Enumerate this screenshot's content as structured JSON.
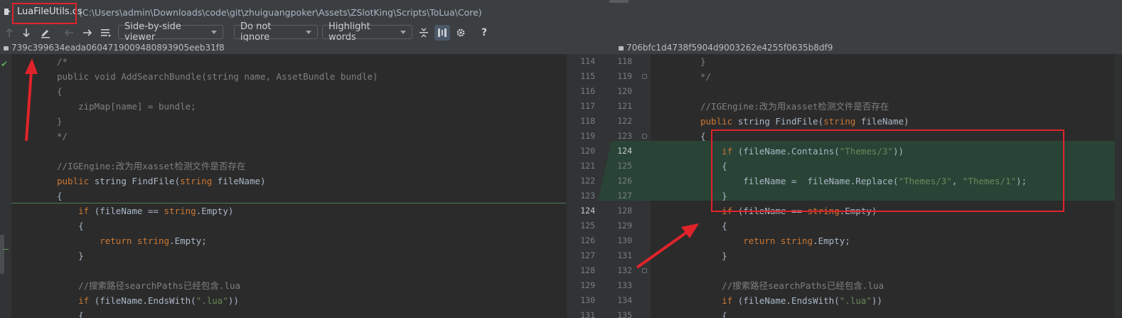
{
  "window": {
    "file_name": "LuaFileUtils.cs",
    "file_path": "(C:\\Users\\admin\\Downloads\\code\\git\\zhuiguangpoker\\Assets\\ZSlotKing\\Scripts\\ToLua\\Core)"
  },
  "toolbar": {
    "viewer_mode": "Side-by-side viewer",
    "ignore_mode": "Do not ignore",
    "highlight_mode": "Highlight words",
    "help_label": "?"
  },
  "revisions": {
    "left_hash": "739c399634eada0604719009480893905eeb31f8",
    "right_hash": "706bfc1d4738f5904d9003262e4255f0635b8df9"
  },
  "left_lines": [
    [
      {
        "t": "/*",
        "c": "cm"
      }
    ],
    [
      {
        "t": "public ",
        "c": "cm"
      },
      {
        "t": "void AddSearchBundle(string name, AssetBundle bundle)",
        "c": "cm"
      }
    ],
    [
      {
        "t": "{",
        "c": "cm"
      }
    ],
    [
      {
        "t": "    zipMap[name] = bundle;",
        "c": "cm"
      }
    ],
    [
      {
        "t": "}",
        "c": "cm"
      }
    ],
    [
      {
        "t": "*/",
        "c": "cm"
      }
    ],
    [
      {
        "t": "",
        "c": ""
      }
    ],
    [
      {
        "t": "//IGEngine:改为用xasset检测文件是否存在",
        "c": "cm"
      }
    ],
    [
      {
        "t": "public ",
        "c": "kw"
      },
      {
        "t": "string FindFile(",
        "c": ""
      },
      {
        "t": "string ",
        "c": "kw"
      },
      {
        "t": "fileName)",
        "c": ""
      }
    ],
    [
      {
        "t": "{",
        "c": ""
      }
    ],
    [
      {
        "t": "    ",
        "c": ""
      },
      {
        "t": "if ",
        "c": "kw"
      },
      {
        "t": "(fileName == ",
        "c": ""
      },
      {
        "t": "string",
        "c": "kw"
      },
      {
        "t": ".Empty)",
        "c": ""
      }
    ],
    [
      {
        "t": "    {",
        "c": ""
      }
    ],
    [
      {
        "t": "        ",
        "c": ""
      },
      {
        "t": "return ",
        "c": "kw"
      },
      {
        "t": "string",
        "c": "kw"
      },
      {
        "t": ".Empty;",
        "c": ""
      }
    ],
    [
      {
        "t": "    }",
        "c": ""
      }
    ],
    [
      {
        "t": "",
        "c": ""
      }
    ],
    [
      {
        "t": "    //搜索路径searchPaths已经包含.lua",
        "c": "cm"
      }
    ],
    [
      {
        "t": "    ",
        "c": ""
      },
      {
        "t": "if ",
        "c": "kw"
      },
      {
        "t": "(fileName.EndsWith(",
        "c": ""
      },
      {
        "t": "\".lua\"",
        "c": "str"
      },
      {
        "t": "))",
        "c": ""
      }
    ],
    [
      {
        "t": "    {",
        "c": ""
      }
    ]
  ],
  "right_lines": [
    [
      {
        "t": "}",
        "c": "cm"
      }
    ],
    [
      {
        "t": "*/",
        "c": "cm"
      }
    ],
    [
      {
        "t": "",
        "c": ""
      }
    ],
    [
      {
        "t": "//IGEngine:改为用xasset检测文件是否存在",
        "c": "cm"
      }
    ],
    [
      {
        "t": "public ",
        "c": "kw"
      },
      {
        "t": "string FindFile(",
        "c": ""
      },
      {
        "t": "string ",
        "c": "kw"
      },
      {
        "t": "fileName)",
        "c": ""
      }
    ],
    [
      {
        "t": "{",
        "c": ""
      }
    ],
    [
      {
        "t": "    ",
        "c": ""
      },
      {
        "t": "if ",
        "c": "kw"
      },
      {
        "t": "(fileName.Contains(",
        "c": ""
      },
      {
        "t": "\"Themes/3\"",
        "c": "str"
      },
      {
        "t": "))",
        "c": ""
      }
    ],
    [
      {
        "t": "    {",
        "c": ""
      }
    ],
    [
      {
        "t": "        fileName =  fileName.Replace(",
        "c": ""
      },
      {
        "t": "\"Themes/3\"",
        "c": "str"
      },
      {
        "t": ", ",
        "c": ""
      },
      {
        "t": "\"Themes/1\"",
        "c": "str"
      },
      {
        "t": ");",
        "c": ""
      }
    ],
    [
      {
        "t": "    }",
        "c": ""
      }
    ],
    [
      {
        "t": "    ",
        "c": ""
      },
      {
        "t": "if ",
        "c": "kw"
      },
      {
        "t": "(fileName == ",
        "c": ""
      },
      {
        "t": "string",
        "c": "kw"
      },
      {
        "t": ".Empty)",
        "c": ""
      }
    ],
    [
      {
        "t": "    {",
        "c": ""
      }
    ],
    [
      {
        "t": "        ",
        "c": ""
      },
      {
        "t": "return ",
        "c": "kw"
      },
      {
        "t": "string",
        "c": "kw"
      },
      {
        "t": ".Empty;",
        "c": ""
      }
    ],
    [
      {
        "t": "    }",
        "c": ""
      }
    ],
    [
      {
        "t": "",
        "c": ""
      }
    ],
    [
      {
        "t": "    //搜索路径searchPaths已经包含.lua",
        "c": "cm"
      }
    ],
    [
      {
        "t": "    ",
        "c": ""
      },
      {
        "t": "if ",
        "c": "kw"
      },
      {
        "t": "(fileName.EndsWith(",
        "c": ""
      },
      {
        "t": "\".lua\"",
        "c": "str"
      },
      {
        "t": "))",
        "c": ""
      }
    ],
    [
      {
        "t": "    {",
        "c": ""
      }
    ]
  ],
  "left_line_numbers": [
    "114",
    "115",
    "116",
    "117",
    "118",
    "119",
    "120",
    "121",
    "122",
    "123",
    "124",
    "125",
    "126",
    "127",
    "128",
    "129",
    "130",
    "131"
  ],
  "right_line_numbers": [
    "118",
    "119",
    "120",
    "121",
    "122",
    "123",
    "124",
    "125",
    "126",
    "127",
    "128",
    "129",
    "130",
    "131",
    "132",
    "133",
    "134",
    "135"
  ],
  "highlighted_right_lines": [
    "124",
    "125",
    "126",
    "127"
  ],
  "colors": {
    "keyword": "#cc7832",
    "string": "#6a8759",
    "comment": "#808080",
    "plain": "#a9b7c6",
    "inserted_background": "#294436",
    "annotation_red": "#e0232b"
  }
}
